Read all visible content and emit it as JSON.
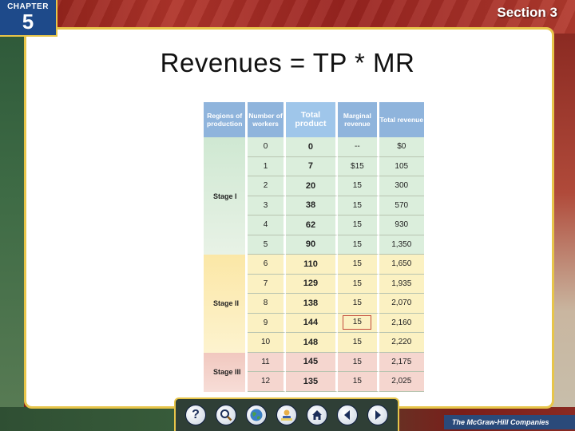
{
  "chapter": {
    "word": "CHAPTER",
    "number": "5"
  },
  "section": {
    "label": "Section 3"
  },
  "title": "Revenues = TP * MR",
  "table": {
    "headers": [
      "Regions of production",
      "Number of workers",
      "Total product",
      "Marginal revenue",
      "Total revenue"
    ],
    "stages": [
      {
        "label": "Stage I",
        "rows": [
          {
            "workers": "0",
            "tp": "0",
            "mr": "--",
            "tr": "$0"
          },
          {
            "workers": "1",
            "tp": "7",
            "mr": "$15",
            "tr": "105"
          },
          {
            "workers": "2",
            "tp": "20",
            "mr": "15",
            "tr": "300"
          },
          {
            "workers": "3",
            "tp": "38",
            "mr": "15",
            "tr": "570"
          },
          {
            "workers": "4",
            "tp": "62",
            "mr": "15",
            "tr": "930"
          },
          {
            "workers": "5",
            "tp": "90",
            "mr": "15",
            "tr": "1,350"
          }
        ]
      },
      {
        "label": "Stage II",
        "rows": [
          {
            "workers": "6",
            "tp": "110",
            "mr": "15",
            "tr": "1,650"
          },
          {
            "workers": "7",
            "tp": "129",
            "mr": "15",
            "tr": "1,935"
          },
          {
            "workers": "8",
            "tp": "138",
            "mr": "15",
            "tr": "2,070"
          },
          {
            "workers": "9",
            "tp": "144",
            "mr": "15",
            "tr": "2,160"
          },
          {
            "workers": "10",
            "tp": "148",
            "mr": "15",
            "tr": "2,220"
          }
        ]
      },
      {
        "label": "Stage III",
        "rows": [
          {
            "workers": "11",
            "tp": "145",
            "mr": "15",
            "tr": "2,175"
          },
          {
            "workers": "12",
            "tp": "135",
            "mr": "15",
            "tr": "2,025"
          }
        ]
      }
    ]
  },
  "nav": {
    "buttons": [
      {
        "name": "help-button",
        "icon": "question-mark-icon",
        "glyph": "?"
      },
      {
        "name": "resources-button",
        "icon": "magnifier-icon",
        "glyph": ""
      },
      {
        "name": "web-button",
        "icon": "globe-icon",
        "glyph": ""
      },
      {
        "name": "study-button",
        "icon": "student-icon",
        "glyph": ""
      },
      {
        "name": "home-button",
        "icon": "home-icon",
        "glyph": ""
      },
      {
        "name": "previous-button",
        "icon": "arrow-left-icon",
        "glyph": ""
      },
      {
        "name": "next-button",
        "icon": "arrow-right-icon",
        "glyph": ""
      }
    ]
  },
  "publisher": "The McGraw-Hill Companies",
  "colors": {
    "accent_gold": "#e7c54a",
    "badge_blue": "#1e4a8a",
    "header_blue": "#8fb4dc"
  }
}
